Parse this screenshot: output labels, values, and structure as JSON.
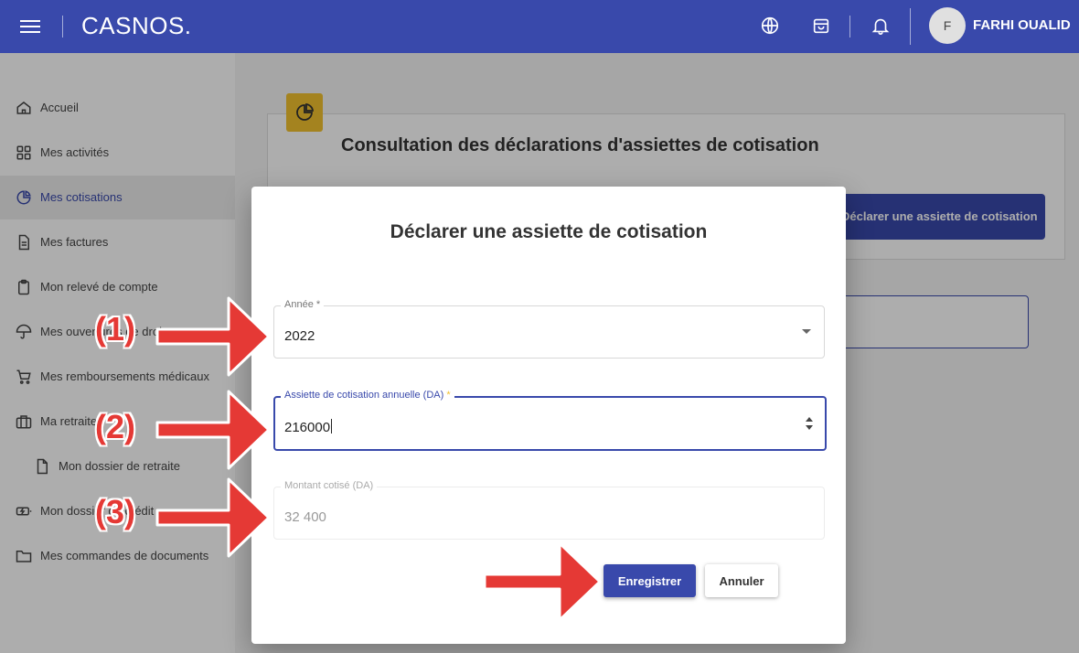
{
  "header": {
    "brand": "CASNOS.",
    "user_initial": "F",
    "user_name": "FARHI OUALID",
    "icons": [
      "globe-icon",
      "shopping-bag-icon",
      "bell-icon"
    ]
  },
  "sidebar": {
    "items": [
      {
        "label": "Accueil",
        "icon": "home-icon"
      },
      {
        "label": "Mes activités",
        "icon": "grid-icon"
      },
      {
        "label": "Mes cotisations",
        "icon": "pie-chart-icon",
        "active": true
      },
      {
        "label": "Mes factures",
        "icon": "document-icon"
      },
      {
        "label": "Mon relevé de compte",
        "icon": "clipboard-icon"
      },
      {
        "label": "Mes ouvertures de droits",
        "icon": "umbrella-icon"
      },
      {
        "label": "Mes remboursements médicaux",
        "icon": "cart-icon"
      },
      {
        "label": "Ma retraite",
        "icon": "briefcase-icon"
      },
      {
        "label": "Mon dossier de retraite",
        "icon": "file-icon",
        "sub": true
      },
      {
        "label": "Mon dossier de crédit",
        "icon": "battery-charging-icon"
      },
      {
        "label": "Mes commandes de documents",
        "icon": "folder-icon"
      }
    ]
  },
  "page": {
    "title": "Consultation des déclarations d'assiettes de cotisation",
    "action_button": "Déclarer une assiette de cotisation"
  },
  "dialog": {
    "title": "Déclarer une assiette de cotisation",
    "fields": {
      "annee": {
        "label": "Année *",
        "value": "2022"
      },
      "assiette": {
        "label": "Assiette de cotisation annuelle (DA)",
        "required_mark": "*",
        "value": "216000"
      },
      "montant": {
        "label": "Montant cotisé (DA)",
        "value": "32 400"
      }
    },
    "save_label": "Enregistrer",
    "cancel_label": "Annuler"
  },
  "annotations": {
    "step1": "(1)",
    "step2": "(2)",
    "step3": "(3)"
  },
  "colors": {
    "primary": "#3949ab",
    "accent": "#f2c12e",
    "annotation_red": "#e53935"
  }
}
